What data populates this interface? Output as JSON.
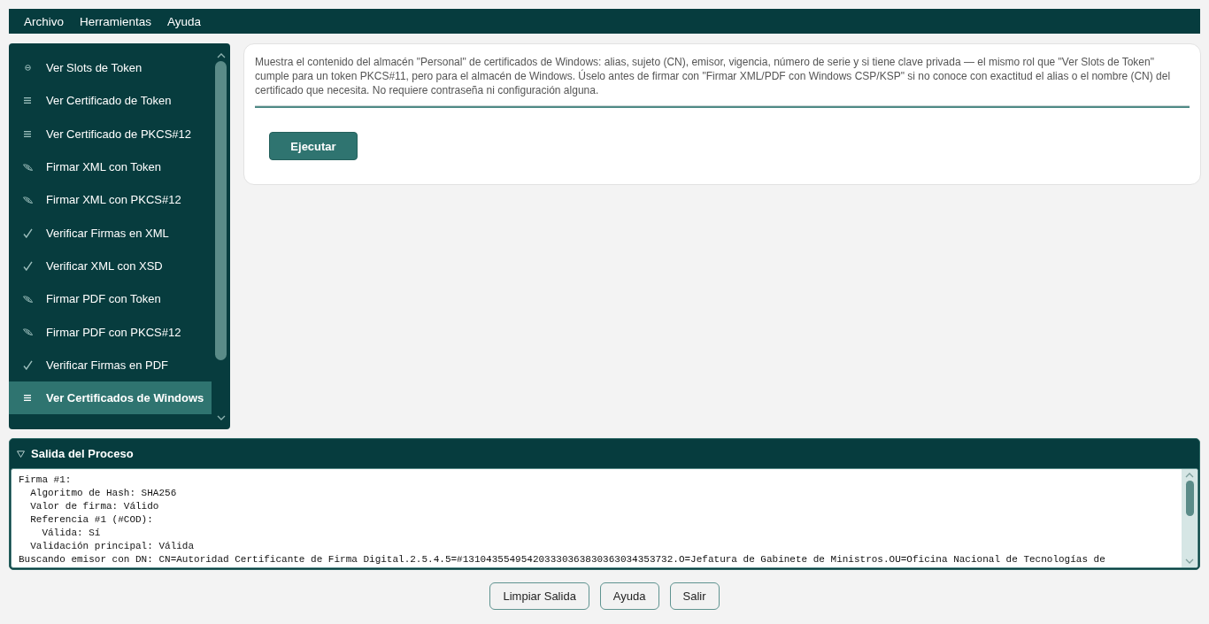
{
  "menu_bar": {
    "items": [
      "Archivo",
      "Herramientas",
      "Ayuda"
    ]
  },
  "sidebar": {
    "items": [
      {
        "label": "Ver Slots de Token",
        "kind": "slots",
        "selected": false
      },
      {
        "label": "Ver Certificado de Token",
        "kind": "view",
        "selected": false
      },
      {
        "label": "Ver Certificado de PKCS#12",
        "kind": "view",
        "selected": false
      },
      {
        "label": "Firmar XML con Token",
        "kind": "sign",
        "selected": false
      },
      {
        "label": "Firmar XML con PKCS#12",
        "kind": "sign",
        "selected": false
      },
      {
        "label": "Verificar Firmas en XML",
        "kind": "verify",
        "selected": false
      },
      {
        "label": "Verificar XML con XSD",
        "kind": "verify",
        "selected": false
      },
      {
        "label": "Firmar PDF con Token",
        "kind": "sign",
        "selected": false
      },
      {
        "label": "Firmar PDF con PKCS#12",
        "kind": "sign",
        "selected": false
      },
      {
        "label": "Verificar Firmas en PDF",
        "kind": "verify",
        "selected": false
      },
      {
        "label": "Ver Certificados de Windows",
        "kind": "view",
        "selected": true
      }
    ]
  },
  "description_card": {
    "text": "Muestra el contenido del almacén \"Personal\" de certificados de Windows: alias, sujeto (CN), emisor, vigencia, número de serie y si tiene clave privada — el mismo rol que \"Ver Slots de Token\" cumple para un token PKCS#11, pero para el almacén de Windows. Úselo antes de firmar con \"Firmar XML/PDF con Windows CSP/KSP\" si no conoce con exactitud el alias o el nombre (CN) del certificado que necesita. No requiere contraseña ni configuración alguna.",
    "action_button": "Ejecutar"
  },
  "output_panel": {
    "title": "Salida del Proceso",
    "expanded": true,
    "lines": [
      "Firma #1:",
      "  Algoritmo de Hash: SHA256",
      "  Valor de firma: Válido",
      "  Referencia #1 (#COD):",
      "    Válida: Sí",
      "  Validación principal: Válida",
      "Buscando emisor con DN: CN=Autoridad Certificante de Firma Digital.2.5.4.5=#131043554954203330363830363034353732.O=Jefatura de Gabinete de Ministros.OU=Oficina Nacional de Tecnologías de"
    ]
  },
  "footer_buttons": [
    "Limpiar Salida",
    "Ayuda",
    "Salir"
  ]
}
